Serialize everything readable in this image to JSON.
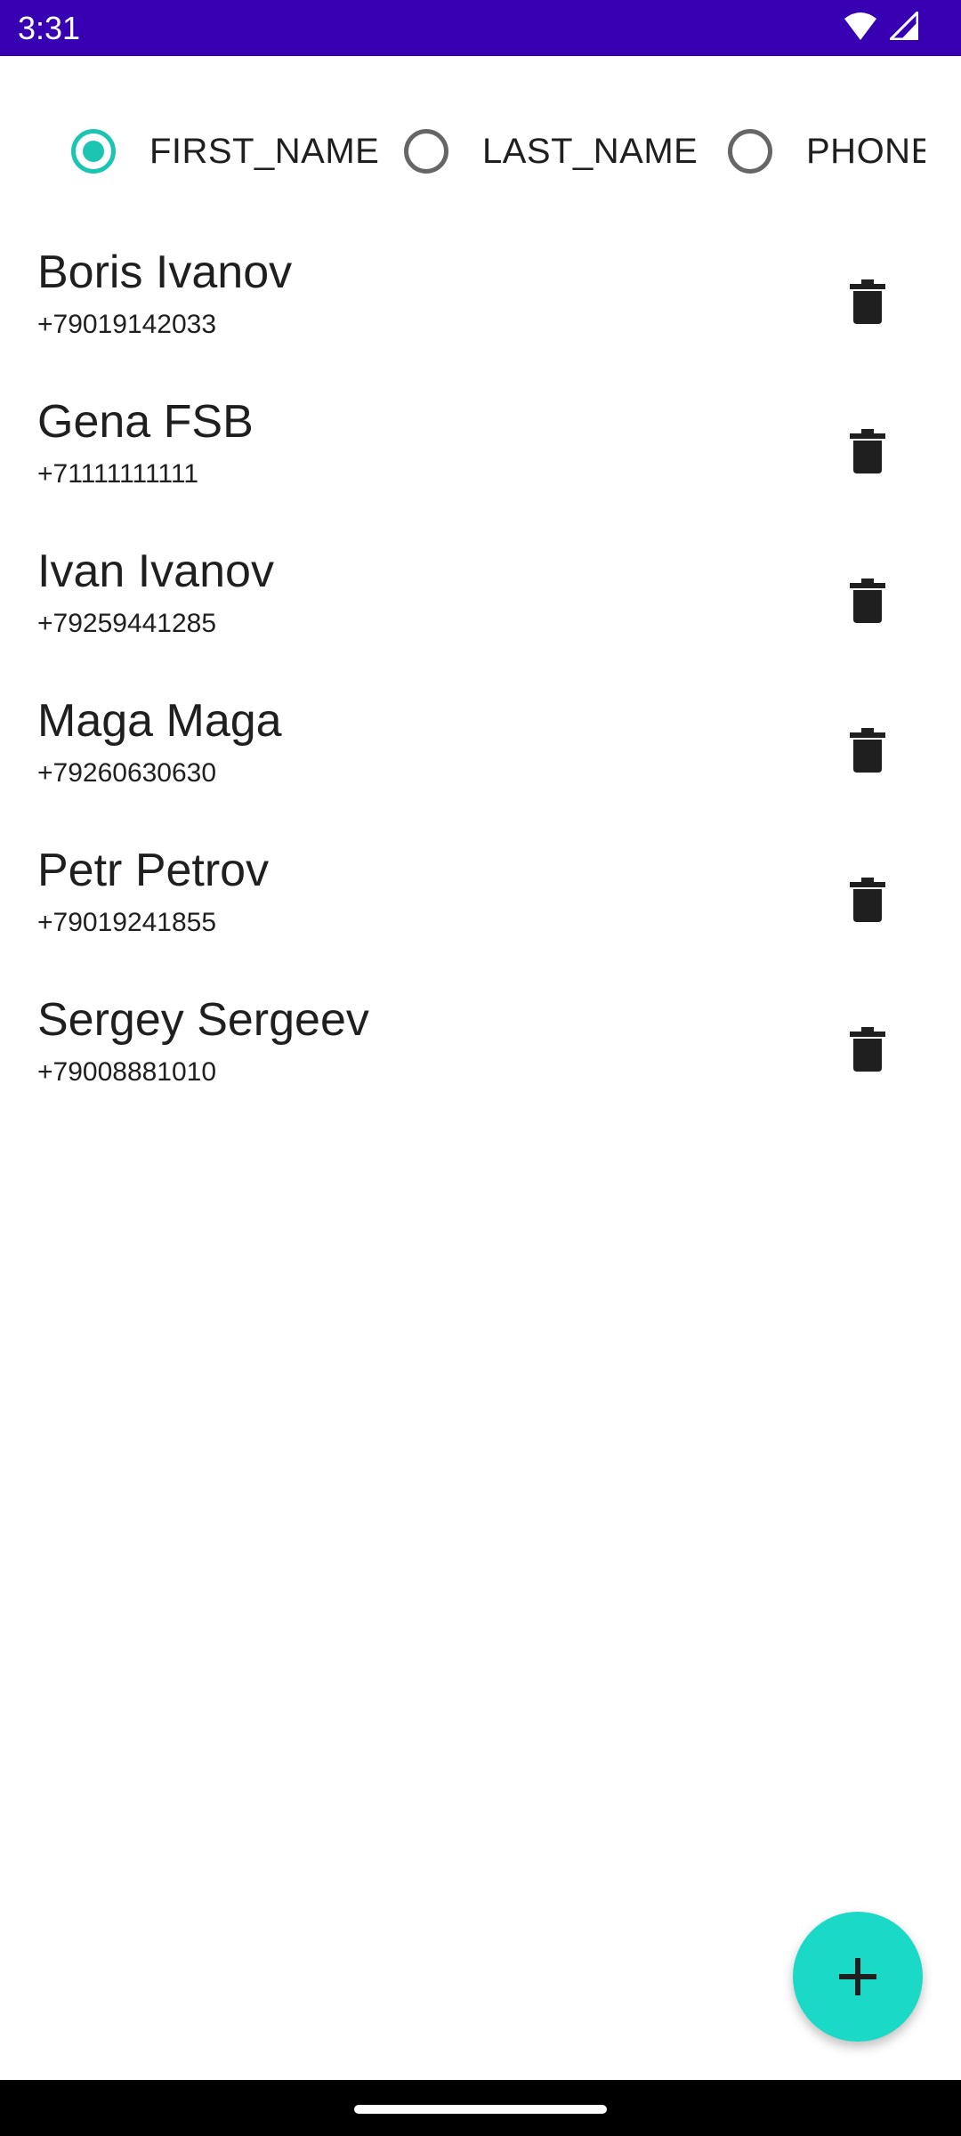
{
  "status_bar": {
    "time": "3:31",
    "background": "#3700b3",
    "icons": [
      "wifi-icon",
      "cell-signal-icon"
    ]
  },
  "sort_options": {
    "selected": "FIRST_NAME",
    "accent_color": "#1cc4b2",
    "options": [
      {
        "label": "FIRST_NAME",
        "checked": true
      },
      {
        "label": "LAST_NAME",
        "checked": false
      },
      {
        "label": "PHONE",
        "checked": false
      }
    ]
  },
  "contacts": [
    {
      "name": "Boris Ivanov",
      "phone": "+79019142033",
      "delete_icon": "trash-icon"
    },
    {
      "name": "Gena FSB",
      "phone": "+71111111111",
      "delete_icon": "trash-icon"
    },
    {
      "name": "Ivan Ivanov",
      "phone": "+79259441285",
      "delete_icon": "trash-icon"
    },
    {
      "name": "Maga Maga",
      "phone": "+79260630630",
      "delete_icon": "trash-icon"
    },
    {
      "name": "Petr Petrov",
      "phone": "+79019241855",
      "delete_icon": "trash-icon"
    },
    {
      "name": "Sergey Sergeev",
      "phone": "+79008881010",
      "delete_icon": "trash-icon"
    }
  ],
  "fab": {
    "icon": "plus-icon",
    "color": "#1ad9c6"
  },
  "nav_bar": {
    "background": "#000000"
  }
}
